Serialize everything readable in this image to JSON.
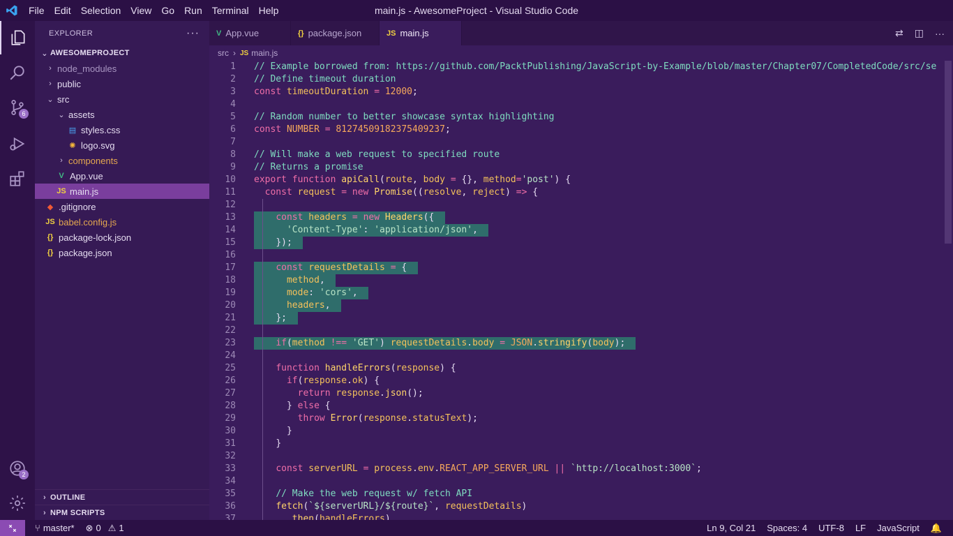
{
  "window": {
    "title": "main.js - AwesomeProject - Visual Studio Code"
  },
  "menu": [
    "File",
    "Edit",
    "Selection",
    "View",
    "Go",
    "Run",
    "Terminal",
    "Help"
  ],
  "activity": {
    "source_control_badge": "6",
    "accounts_badge": "2"
  },
  "sidebar": {
    "title": "EXPLORER",
    "more": "···",
    "project": "AWESOMEPROJECT",
    "items": [
      {
        "label": "node_modules",
        "icon": "chevron-right"
      },
      {
        "label": "public",
        "icon": "chevron-right"
      },
      {
        "label": "src",
        "icon": "chevron-down"
      },
      {
        "label": "assets",
        "icon": "chevron-down"
      },
      {
        "label": "styles.css",
        "icon": "css-file-icon"
      },
      {
        "label": "logo.svg",
        "icon": "svg-file-icon"
      },
      {
        "label": "components",
        "icon": "chevron-right"
      },
      {
        "label": "App.vue",
        "icon": "vue-file-icon"
      },
      {
        "label": "main.js",
        "icon": "js-file-icon"
      },
      {
        "label": ".gitignore",
        "icon": "git-file-icon"
      },
      {
        "label": "babel.config.js",
        "icon": "js-file-icon"
      },
      {
        "label": "package-lock.json",
        "icon": "json-file-icon"
      },
      {
        "label": "package.json",
        "icon": "json-file-icon"
      }
    ],
    "outline": "OUTLINE",
    "npm_scripts": "NPM SCRIPTS"
  },
  "tabs": [
    {
      "label": "App.vue",
      "icon": "vue-file-icon"
    },
    {
      "label": "package.json",
      "icon": "json-file-icon"
    },
    {
      "label": "main.js",
      "icon": "js-file-icon"
    }
  ],
  "breadcrumb": {
    "folder": "src",
    "file": "main.js"
  },
  "code": {
    "line_numbers": [
      "1",
      "2",
      "3",
      "4",
      "5",
      "6",
      "7",
      "8",
      "9",
      "10",
      "11",
      "12",
      "13",
      "14",
      "15",
      "16",
      "17",
      "18",
      "19",
      "20",
      "21",
      "22",
      "23",
      "24",
      "25",
      "26",
      "27",
      "28",
      "29",
      "30",
      "31",
      "32",
      "33",
      "34",
      "35",
      "36",
      "37"
    ],
    "lines": [
      "// Example borrowed from: https://github.com/PacktPublishing/JavaScript-by-Example/blob/master/Chapter07/CompletedCode/src/se",
      "// Define timeout duration",
      "const timeoutDuration = 12000;",
      "",
      "// Random number to better showcase syntax highlighting",
      "const NUMBER = 812745091823754O9237;",
      "",
      "// Will make a web request to specified route",
      "// Returns a promise",
      "export function apiCall(route, body = {}, method='post') {",
      "  const request = new Promise((resolve, reject) => {",
      "",
      "    const headers = new Headers({",
      "      'Content-Type': 'application/json',",
      "    });",
      "",
      "    const requestDetails = {",
      "      method,",
      "      mode: 'cors',",
      "      headers,",
      "    };",
      "",
      "    if(method !== 'GET') requestDetails.body = JSON.stringify(body);",
      "",
      "    function handleErrors(response) {",
      "      if(response.ok) {",
      "        return response.json();",
      "      } else {",
      "        throw Error(response.statusText);",
      "      }",
      "    }",
      "",
      "    const serverURL = process.env.REACT_APP_SERVER_URL || `http://localhost:3000`;",
      "",
      "    // Make the web request w/ fetch API",
      "    fetch(`${serverURL}/${route}`, requestDetails)",
      "      .then(handleErrors)"
    ]
  },
  "status": {
    "branch": "master*",
    "errors": "0",
    "warnings": "1",
    "cursor": "Ln 9, Col 21",
    "spaces": "Spaces: 4",
    "encoding": "UTF-8",
    "eol": "LF",
    "language": "JavaScript"
  },
  "colors": {
    "background": "#3a1c5c",
    "sidebar": "#361a55",
    "titlebar": "#2b1045",
    "selection": "#2f6d6b",
    "accent": "#8b4bb3"
  }
}
